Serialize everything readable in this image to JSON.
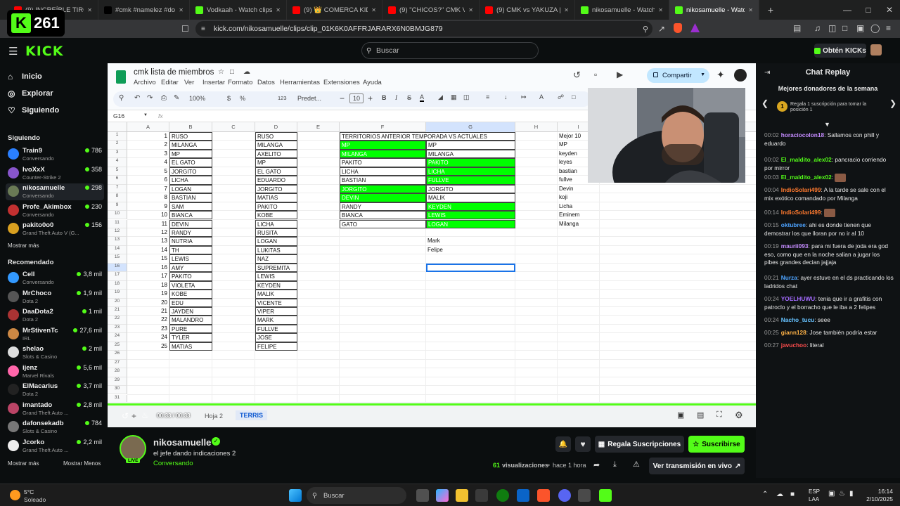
{
  "overlay_badge": {
    "letter": "K",
    "number": "261"
  },
  "browser": {
    "tabs": [
      {
        "label": "(9) INCREÍBLE TIROTEO 🐙 CMK",
        "color": "#ff0000"
      },
      {
        "label": "#cmk #namelez #dovuxlife #gt",
        "color": "#000000"
      },
      {
        "label": "Vodkaah - Watch clips on Kick",
        "color": "#53fc18"
      },
      {
        "label": "(9) 👑 COMERCA KIDS - CMK",
        "color": "#ff0000"
      },
      {
        "label": "(9) \"CHICOS?\" CMK VS NMZ en",
        "color": "#ff0000"
      },
      {
        "label": "(9) CMK vs YAKUZA | GRAFITI",
        "color": "#ff0000"
      },
      {
        "label": "nikosamuelle - Watch clips on",
        "color": "#53fc18"
      },
      {
        "label": "nikosamuelle - Watch clip",
        "color": "#53fc18"
      }
    ],
    "new_tab": "+",
    "url": "kick.com/nikosamuelle/clips/clip_01K6K0AFFRJARARX6N0BMJG879"
  },
  "kick": {
    "logo": "KICK",
    "search_placeholder": "Buscar",
    "get_kicks": "Obtén KICKs"
  },
  "sidebar": {
    "nav": [
      {
        "label": "Inicio",
        "icon": "home-icon"
      },
      {
        "label": "Explorar",
        "icon": "compass-icon"
      },
      {
        "label": "Siguiendo",
        "icon": "heart-icon"
      }
    ],
    "following_title": "Siguiendo",
    "following": [
      {
        "name": "Train9",
        "sub": "Conversando",
        "viewers": "786",
        "color": "#2a7fff"
      },
      {
        "name": "IvoXxX",
        "sub": "Counter-Strike 2",
        "viewers": "358",
        "color": "#8855cc"
      },
      {
        "name": "nikosamuelle",
        "sub": "Conversando",
        "viewers": "298",
        "color": "#6a7a55"
      },
      {
        "name": "Profe_Akimbox",
        "sub": "Conversando",
        "viewers": "230",
        "color": "#c23030"
      },
      {
        "name": "pakito0o0",
        "sub": "Grand Theft Auto V (G...",
        "viewers": "156",
        "color": "#d9a020"
      }
    ],
    "show_more": "Mostrar más",
    "recommended_title": "Recomendado",
    "recommended": [
      {
        "name": "Cell",
        "sub": "Conversando",
        "viewers": "3,8 mil",
        "color": "#3399ff"
      },
      {
        "name": "MrChoco",
        "sub": "Dota 2",
        "viewers": "1,9 mil",
        "color": "#555555"
      },
      {
        "name": "DaaDota2",
        "sub": "Dota 2",
        "viewers": "1 mil",
        "color": "#aa3333"
      },
      {
        "name": "MrStivenTc",
        "sub": "IRL",
        "viewers": "27,6 mil",
        "color": "#cc8844"
      },
      {
        "name": "shelao",
        "sub": "Slots & Casino",
        "viewers": "2 mil",
        "color": "#dddddd"
      },
      {
        "name": "ijenz",
        "sub": "Marvel Rivals",
        "viewers": "5,6 mil",
        "color": "#ff66aa"
      },
      {
        "name": "ElMacarius",
        "sub": "Dota 2",
        "viewers": "3,7 mil",
        "color": "#222222"
      },
      {
        "name": "imantado",
        "sub": "Grand Theft Auto ...",
        "viewers": "2,8 mil",
        "color": "#bb4466"
      },
      {
        "name": "dafonsekadb",
        "sub": "Slots & Casino",
        "viewers": "784",
        "color": "#777777"
      },
      {
        "name": "Jcorko",
        "sub": "Grand Theft Auto ...",
        "viewers": "2,2 mil",
        "color": "#eeeeee"
      }
    ],
    "show_more_2": "Mostrar más",
    "show_less": "Mostrar Menos"
  },
  "sheet": {
    "title": "cmk lista de miembros",
    "menus": [
      "Archivo",
      "Editar",
      "Ver",
      "Insertar",
      "Formato",
      "Datos",
      "Herramientas",
      "Extensiones",
      "Ayuda"
    ],
    "share": "Compartir",
    "zoom": "100%",
    "font": "Predet...",
    "font_size": "10",
    "currency": "$",
    "percent": "%",
    "numfmt": "123",
    "cell_ref": "G16",
    "fx": "fx",
    "columns": [
      "A",
      "B",
      "C",
      "D",
      "E",
      "F",
      "G",
      "H",
      "I"
    ],
    "row_numbers": [
      "1",
      "2",
      "3",
      "4",
      "5",
      "6",
      "7",
      "8",
      "9",
      "10",
      "11",
      "12",
      "13",
      "14",
      "15",
      "16",
      "17",
      "18",
      "19",
      "20",
      "21",
      "22",
      "23",
      "24",
      "25",
      "26",
      "27",
      "28",
      "29",
      "30",
      "31"
    ],
    "colA": [
      "1",
      "2",
      "3",
      "4",
      "5",
      "6",
      "7",
      "8",
      "9",
      "10",
      "11",
      "12",
      "13",
      "14",
      "15",
      "16",
      "17",
      "18",
      "19",
      "20",
      "21",
      "22",
      "23",
      "24",
      "25"
    ],
    "colB": [
      "RUSO",
      "MILANGA",
      "MP",
      "EL GATO",
      "JORGITO",
      "LICHA",
      "LOGAN",
      "BASTIAN",
      "SAM",
      "BIANCA",
      "DEVIN",
      "RANDY",
      "NUTRIA",
      "TH",
      "LEWIS",
      "AMY",
      "PAKITO",
      "VIOLETA",
      "KOBE",
      "EDU",
      "JAYDEN",
      "MALANDRO",
      "PURE",
      "TYLER",
      "MATIAS"
    ],
    "colD": [
      "RUSO",
      "MILANGA",
      "AXELITO",
      "MP",
      "EL GATO",
      "EDUARDO",
      "JORGITO",
      "MATIAS",
      "PAKITO",
      "KOBE",
      "LICHA",
      "RUSITA",
      "LOGAN",
      "LUKITAS",
      "NAZ",
      "SUPREMITA",
      "LEWIS",
      "KEYDEN",
      "MALIK",
      "VICENTE",
      "VIPER",
      "MARK",
      "FULLVE",
      "JOSE",
      "FELIPE"
    ],
    "territory_title": "TERRITORIOS ANTERIOR TEMPORADA VS ACTUALES",
    "colF": [
      "MP",
      "MILANGA",
      "PAKITO",
      "LICHA",
      "BASTIAN",
      "JORGITO",
      "DEVIN",
      "RANDY",
      "BIANCA",
      "GATO"
    ],
    "colG": [
      "MP",
      "MILANGA",
      "PAKITO",
      "LICHA",
      "FULLVE",
      "JORGITO",
      "MALIK",
      "KEYDEN",
      "LEWIS",
      "LOGAN"
    ],
    "extraG": [
      "Mark",
      "Felipe"
    ],
    "colI_title": "Mejor 10",
    "colI": [
      "MP",
      "keyden",
      "leyes",
      "bastian",
      "fullve",
      "Devin",
      "koji",
      "Licha",
      "Eminem",
      "Milanga"
    ],
    "tabs": [
      "Hoja 2",
      "TERRIS"
    ],
    "time": "00:33 / 00:33"
  },
  "streamer": {
    "name": "nikosamuelle",
    "live": "LIVE",
    "title": "el jefe dando indicaciones 2",
    "category": "Conversando",
    "views_count": "61",
    "views_label": "visualizaciones",
    "ago": "hace 1 hora",
    "gift_subs": "Regala Suscripciones",
    "subscribe": "Suscribirse",
    "watch_live": "Ver transmisión en vivo"
  },
  "chat": {
    "title": "Chat Replay",
    "donors_title": "Mejores donadores de la semana",
    "donor_rank": "1",
    "donor_text": "Regala 1 suscripción para tomar la posición 1",
    "messages": [
      {
        "time": "00:02",
        "user": "horaciocolon18",
        "color": "#c58cff",
        "text": "Sallamos con phill y eduardo"
      },
      {
        "time": "00:02",
        "user": "El_maldito_alex02",
        "color": "#53fc18",
        "text": "pancracio corriendo por mirror"
      },
      {
        "time": "00:03",
        "user": "El_maldito_alex02",
        "color": "#53fc18",
        "text": ""
      },
      {
        "time": "00:04",
        "user": "IndioSolari499",
        "color": "#ff7a2f",
        "text": "A la tarde se sale con el mix exótico comandado por Milanga"
      },
      {
        "time": "00:14",
        "user": "IndioSolari499",
        "color": "#ff7a2f",
        "text": ""
      },
      {
        "time": "00:15",
        "user": "oktubree",
        "color": "#4da3ff",
        "text": "ahi es donde tienen que demostrar los que lloran por no ir al 10"
      },
      {
        "time": "00:19",
        "user": "maurii093",
        "color": "#c58cff",
        "text": "para mi fuera de joda era god eso, como que en la noche salian a jugar los pibes grandes decian jajjaja"
      },
      {
        "time": "00:21",
        "user": "Nurza",
        "color": "#4da3ff",
        "text": "ayer estuve en el ds practicando los ladridos chat"
      },
      {
        "time": "00:24",
        "user": "YOELHUWU",
        "color": "#a46bff",
        "text": "tenia que ir a grafitis con patroclo y el borracho que le iba a 2 felipes"
      },
      {
        "time": "00:24",
        "user": "Nacho_tucu",
        "color": "#66c2ff",
        "text": "seee"
      },
      {
        "time": "00:25",
        "user": "giann128",
        "color": "#ffb347",
        "text": "Jose también podría estar"
      },
      {
        "time": "00:27",
        "user": "javuchoo",
        "color": "#ff4d4d",
        "text": "literal"
      }
    ]
  },
  "taskbar": {
    "temp": "5°C",
    "weather": "Soleado",
    "search": "Buscar",
    "lang": "ESP",
    "lang2": "LAA",
    "time": "16:14",
    "date": "2/10/2025"
  }
}
